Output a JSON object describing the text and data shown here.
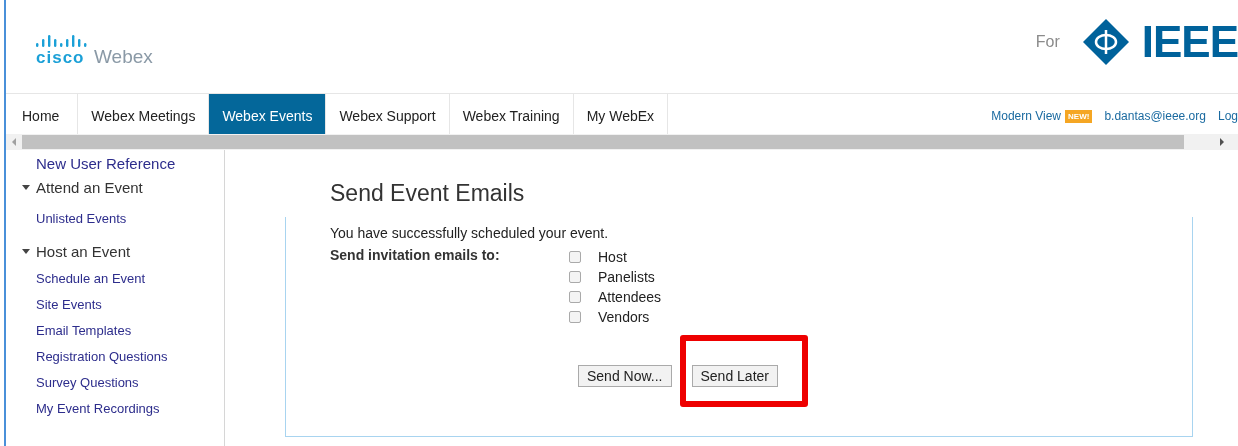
{
  "header": {
    "logo_mark": "cisco",
    "logo_product": "Webex",
    "partner_prefix": "For",
    "partner_name": "IEEE"
  },
  "nav": {
    "tabs": [
      {
        "label": "Home",
        "selected": false
      },
      {
        "label": "Webex Meetings",
        "selected": false
      },
      {
        "label": "Webex Events",
        "selected": true
      },
      {
        "label": "Webex Support",
        "selected": false
      },
      {
        "label": "Webex Training",
        "selected": false
      },
      {
        "label": "My WebEx",
        "selected": false
      }
    ],
    "links": [
      {
        "label": "Modern View",
        "badge": "NEW!"
      },
      {
        "label": "b.dantas@ieee.org"
      },
      {
        "label": "Log"
      }
    ]
  },
  "sidebar": {
    "items": [
      {
        "kind": "link",
        "label": "New User Reference"
      },
      {
        "kind": "group",
        "label": "Attend an Event",
        "expanded": true,
        "children": [
          {
            "label": "Unlisted Events"
          }
        ]
      },
      {
        "kind": "group",
        "label": "Host an Event",
        "expanded": true,
        "children": [
          {
            "label": "Schedule an Event"
          },
          {
            "label": "Site Events"
          },
          {
            "label": "Email Templates"
          },
          {
            "label": "Registration Questions"
          },
          {
            "label": "Survey Questions"
          },
          {
            "label": "My Event Recordings"
          }
        ]
      }
    ]
  },
  "main": {
    "title": "Send Event Emails",
    "message": "You have successfully scheduled your event.",
    "recipients_label": "Send invitation emails to:",
    "recipients": [
      {
        "label": "Host",
        "checked": false
      },
      {
        "label": "Panelists",
        "checked": false
      },
      {
        "label": "Attendees",
        "checked": false
      },
      {
        "label": "Vendors",
        "checked": false
      }
    ],
    "buttons": [
      {
        "label": "Send Now...",
        "highlighted": false
      },
      {
        "label": "Send Later",
        "highlighted": true
      }
    ]
  }
}
